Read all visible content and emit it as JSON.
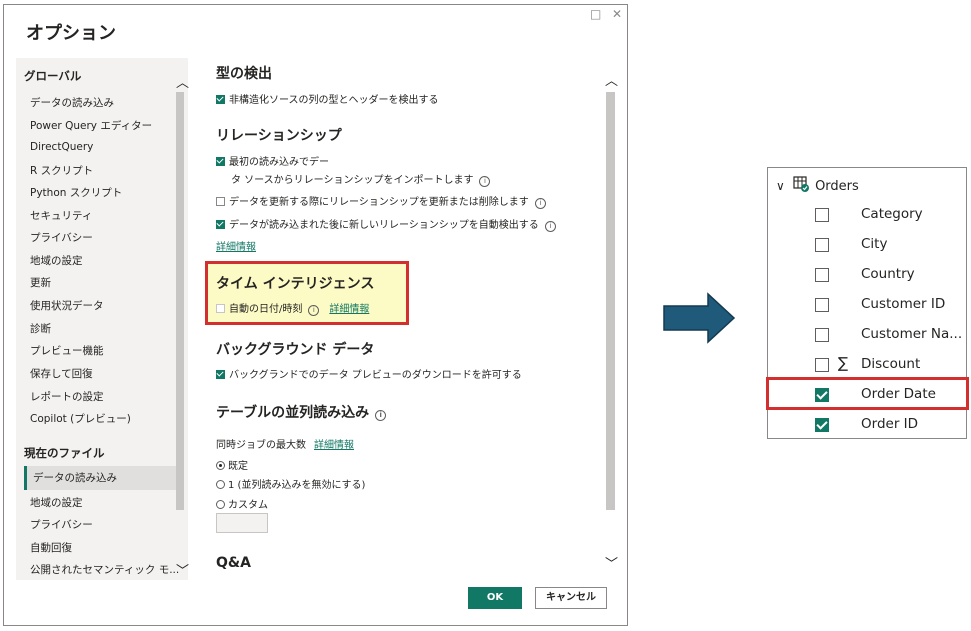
{
  "dialog": {
    "title": "オプション",
    "window_controls": {
      "maximize": "□",
      "close": "✕"
    },
    "sidebar": {
      "global_header": "グローバル",
      "global_items": [
        "データの読み込み",
        "Power Query エディター",
        "DirectQuery",
        "R スクリプト",
        "Python スクリプト",
        "セキュリティ",
        "プライバシー",
        "地域の設定",
        "更新",
        "使用状況データ",
        "診断",
        "プレビュー機能",
        "保存して回復",
        "レポートの設定",
        "Copilot (プレビュー)"
      ],
      "file_header": "現在のファイル",
      "file_items": [
        "データの読み込み",
        "地域の設定",
        "プライバシー",
        "自動回復",
        "公開されたセマンティック モ..."
      ],
      "selected_item": "データの読み込み"
    },
    "content": {
      "type_detect": {
        "heading": "型の検出",
        "option": "非構造化ソースの列の型とヘッダーを検出する",
        "checked": true
      },
      "relationships": {
        "heading": "リレーションシップ",
        "option1_line1": "最初の読み込みでデー",
        "option1_line2": "タ ソースからリレーションシップをインポートします",
        "option1_checked": true,
        "option2": "データを更新する際にリレーションシップを更新または削除します",
        "option2_checked": false,
        "option3": "データが読み込まれた後に新しいリレーションシップを自動検出する",
        "option3_checked": true,
        "more_info": "詳細情報"
      },
      "time_intelligence": {
        "heading": "タイム インテリジェンス",
        "option": "自動の日付/時刻",
        "checked": false,
        "more_info": "詳細情報"
      },
      "background": {
        "heading": "バックグラウンド データ",
        "option": "バックグランドでのデータ プレビューのダウンロードを許可する",
        "checked": true
      },
      "parallel": {
        "heading": "テーブルの並列読み込み",
        "max_jobs": "同時ジョブの最大数",
        "more_info": "詳細情報",
        "radio_default": "既定",
        "radio_one": "1 (並列読み込みを無効にする)",
        "radio_custom": "カスタム",
        "selected": "既定"
      },
      "qa": {
        "heading": "Q&A"
      },
      "info_glyph": "i"
    },
    "buttons": {
      "ok": "OK",
      "cancel": "キャンセル"
    },
    "scroll_glyphs": {
      "up": "︿",
      "down": "﹀"
    }
  },
  "fields_panel": {
    "table_name": "Orders",
    "expand_glyph": "∨",
    "sigma_glyph": "∑",
    "fields": [
      {
        "name": "Category",
        "checked": false
      },
      {
        "name": "City",
        "checked": false
      },
      {
        "name": "Country",
        "checked": false
      },
      {
        "name": "Customer ID",
        "checked": false
      },
      {
        "name": "Customer Na...",
        "checked": false
      },
      {
        "name": "Discount",
        "checked": false,
        "sigma": true
      },
      {
        "name": "Order Date",
        "checked": true
      },
      {
        "name": "Order ID",
        "checked": true
      }
    ]
  },
  "colors": {
    "accent": "#117865",
    "highlight_border": "#d32f2f",
    "highlight_fill": "#fdfbc5",
    "arrow": "#1f5a7a"
  }
}
